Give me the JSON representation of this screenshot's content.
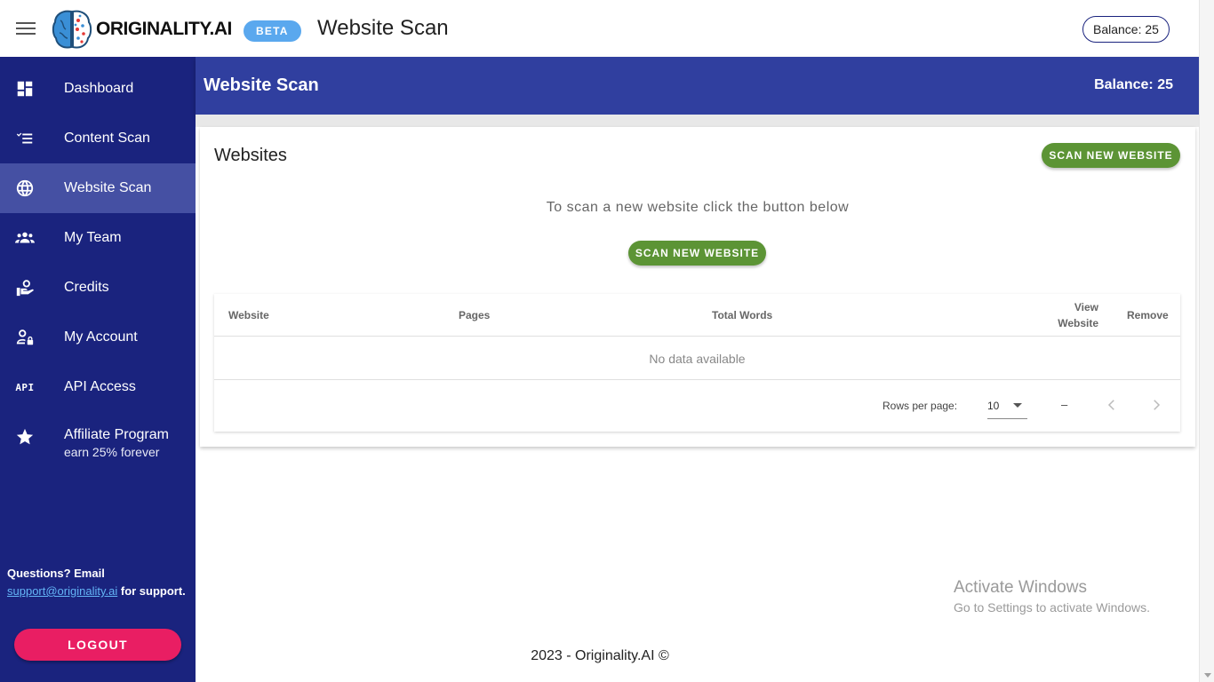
{
  "topbar": {
    "logo_text": "ORIGINALITY.AI",
    "beta_label": "BETA",
    "title": "Website Scan",
    "balance": "Balance: 25"
  },
  "sidebar": {
    "items": [
      {
        "label": "Dashboard",
        "icon": "dashboard-icon"
      },
      {
        "label": "Content Scan",
        "icon": "checklist-icon"
      },
      {
        "label": "Website Scan",
        "icon": "globe-icon",
        "active": true
      },
      {
        "label": "My Team",
        "icon": "team-icon"
      },
      {
        "label": "Credits",
        "icon": "credits-icon"
      },
      {
        "label": "My Account",
        "icon": "account-lock-icon"
      },
      {
        "label": "API Access",
        "icon": "api-icon",
        "icon_text": "API"
      },
      {
        "label": "Affiliate Program",
        "sublabel": "earn 25% forever",
        "icon": "star-icon"
      }
    ],
    "support_prefix": "Questions? Email",
    "support_email": "support@originality.ai",
    "support_suffix": " for support.",
    "logout_label": "LOGOUT"
  },
  "main": {
    "header_title": "Website Scan",
    "header_balance": "Balance: 25",
    "card_title": "Websites",
    "scan_button_label": "SCAN NEW WEBSITE",
    "hint": "To scan a new website click the button below",
    "table": {
      "columns": [
        "Website",
        "Pages",
        "Total Words",
        "View Website",
        "Remove"
      ],
      "empty_text": "No data available",
      "rows_per_page_label": "Rows per page:",
      "rows_per_page_value": "10",
      "range_text": "–"
    }
  },
  "watermark": {
    "title": "Activate Windows",
    "subtitle": "Go to Settings to activate Windows."
  },
  "footer": {
    "copyright": "2023 - Originality.AI ©"
  },
  "colors": {
    "sidebar": "#1a237e",
    "sidebar_active": "#4550a3",
    "header": "#303f9f",
    "accent_green": "#5c9435",
    "logout": "#e91e63",
    "beta": "#5aa8ee"
  }
}
